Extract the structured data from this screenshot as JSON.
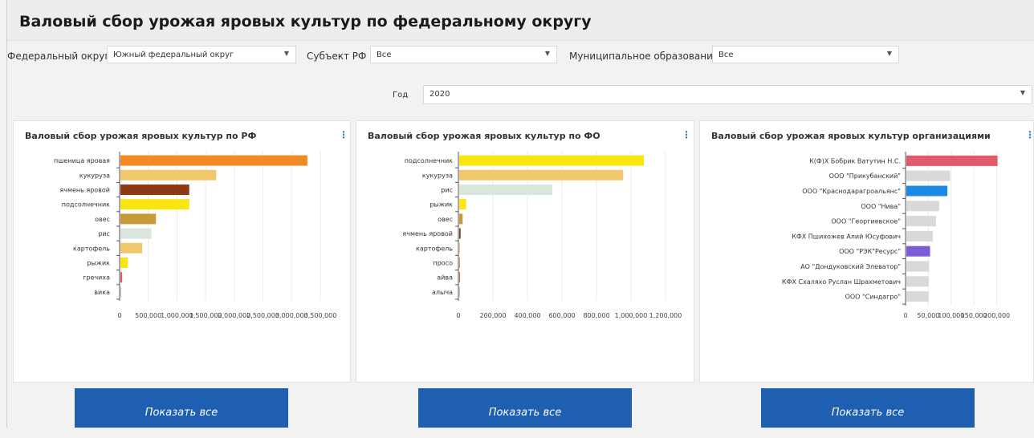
{
  "page": {
    "title": "Валовый сбор урожая яровых культур по федеральному округу"
  },
  "filters": {
    "okrug_label": "Федеральный округ",
    "okrug_value": "Южный федеральный округ",
    "subject_label": "Субъект РФ",
    "subject_value": "Все",
    "municipal_label": "Муниципальное образование",
    "municipal_value": "Все",
    "year_label": "Год",
    "year_value": "2020"
  },
  "panels": [
    {
      "title": "Валовый сбор урожая яровых культур по РФ",
      "menu_icon": "kebab-icon",
      "button_label": "Показать все"
    },
    {
      "title": "Валовый сбор урожая яровых культур по ФО",
      "menu_icon": "kebab-icon",
      "button_label": "Показать все"
    },
    {
      "title": "Валовый сбор урожая яровых культур организациями",
      "menu_icon": "kebab-icon",
      "button_label": "Показать все"
    }
  ],
  "chart_data": [
    {
      "type": "bar",
      "orientation": "horizontal",
      "categories": [
        "пшеница яровая",
        "кукуруза",
        "ячмень яровой",
        "подсолнечник",
        "овес",
        "рис",
        "картофель",
        "рыжик",
        "гречиха",
        "вика"
      ],
      "values": [
        3260000,
        1670000,
        1200000,
        1200000,
        620000,
        540000,
        380000,
        130000,
        30000,
        8000
      ],
      "colors": [
        "#f28a24",
        "#f2c86e",
        "#8b3a14",
        "#f9e510",
        "#c99a3a",
        "#d9e6dd",
        "#f2c86e",
        "#f9e510",
        "#e05a5a",
        "#c0c0c0"
      ],
      "xlim": [
        0,
        3500000
      ],
      "xticks": [
        "0",
        "500,000",
        "1,000,000",
        "1,500,000",
        "2,000,000",
        "2,500,000",
        "3,000,000",
        "3,500,000"
      ],
      "grid": true
    },
    {
      "type": "bar",
      "orientation": "horizontal",
      "categories": [
        "подсолнечник",
        "кукуруза",
        "рис",
        "рыжик",
        "овес",
        "ячмень яровой",
        "картофель",
        "просо",
        "айва",
        "алыча"
      ],
      "values": [
        1070000,
        950000,
        540000,
        40000,
        20000,
        8000,
        3000,
        2000,
        500,
        300
      ],
      "colors": [
        "#f9e510",
        "#f2c86e",
        "#d9e6dd",
        "#f9e510",
        "#c99a3a",
        "#8b3a14",
        "#f2c86e",
        "#c99a3a",
        "#e05a5a",
        "#c0c0c0"
      ],
      "xlim": [
        0,
        1200000
      ],
      "xticks": [
        "0",
        "200,000",
        "400,000",
        "600,000",
        "800,000",
        "1,000,000",
        "1,200,000"
      ],
      "grid": true
    },
    {
      "type": "bar",
      "orientation": "horizontal",
      "categories": [
        "К(Ф)Х Бобрик Ватутин Н.С.",
        "ООО \"Прикубанский\"",
        "ООО \"Краснодарагроальянс\"",
        "ООО \"Нива\"",
        "ООО \"Георгиевское\"",
        "КФХ Пшихожев Алий Юсуфович",
        "ООО \"РЭК\"Ресурс\"",
        "АО \"Дондуковский Элеватор\"",
        "КФХ Схаляхо Руслан Шрахметович",
        "ООО \"Синдагро\""
      ],
      "values": [
        200000,
        96000,
        90000,
        72000,
        65000,
        58000,
        52000,
        50000,
        49000,
        49000
      ],
      "colors": [
        "#e05a6a",
        "#d9d9d9",
        "#1a8ae6",
        "#d9d9d9",
        "#d9d9d9",
        "#d9d9d9",
        "#7b5ed6",
        "#d9d9d9",
        "#d9d9d9",
        "#d9d9d9"
      ],
      "xlim": [
        0,
        250000
      ],
      "xticks": [
        "0",
        "50,000",
        "100,000",
        "150,000",
        "200,000"
      ],
      "grid": true
    }
  ]
}
